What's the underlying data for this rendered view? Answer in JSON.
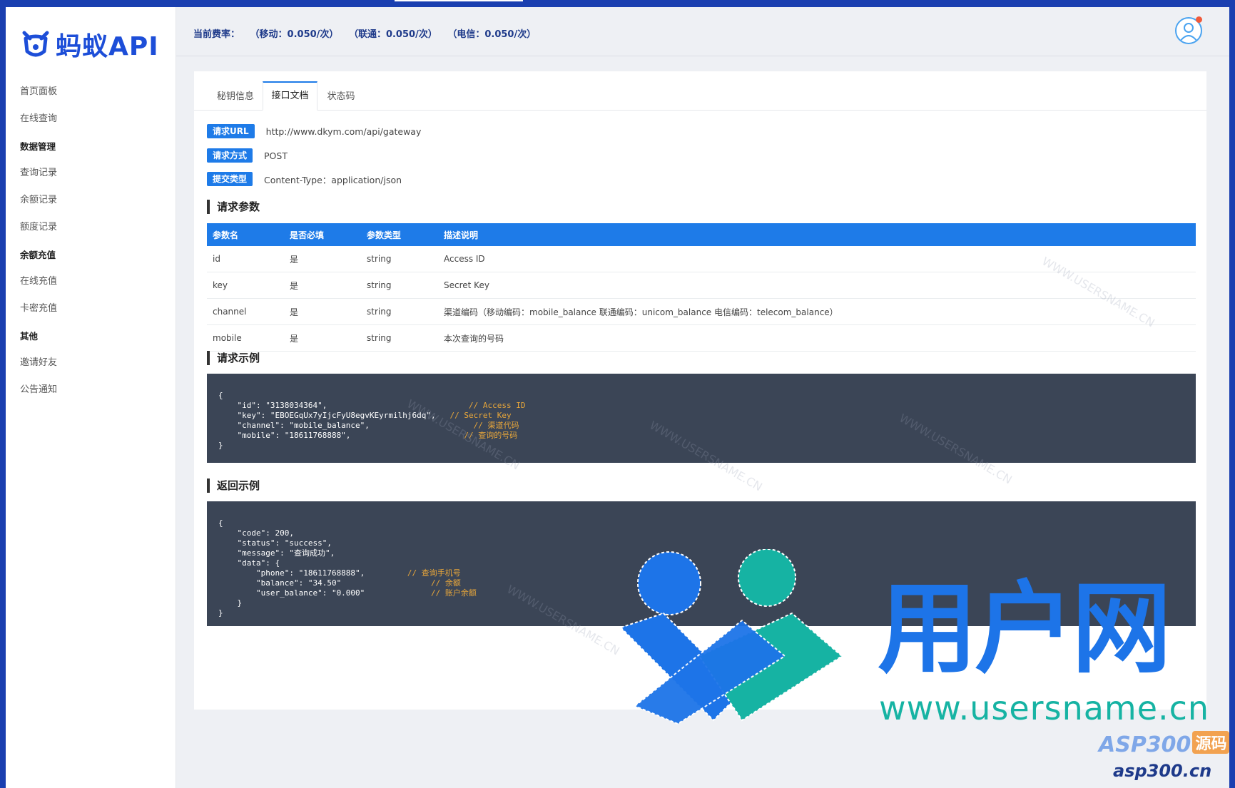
{
  "app": {
    "logo_text": "蚂蚁API"
  },
  "header": {
    "rate_label": "当前费率：",
    "rate_mobile": "（移动：0.050/次）",
    "rate_unicom": "（联通：0.050/次）",
    "rate_telecom": "（电信：0.050/次）"
  },
  "sidebar": {
    "home": "首页面板",
    "online_query": "在线查询",
    "group_data": "数据管理",
    "query_records": "查询记录",
    "balance_records": "余额记录",
    "quota_records": "额度记录",
    "group_recharge": "余额充值",
    "online_recharge": "在线充值",
    "card_recharge": "卡密充值",
    "group_other": "其他",
    "invite": "邀请好友",
    "notice": "公告通知"
  },
  "tabs": [
    "秘钥信息",
    "接口文档",
    "状态码"
  ],
  "info": {
    "url_tag": "请求URL",
    "url_val": "http://www.dkym.com/api/gateway",
    "method_tag": "请求方式",
    "method_val": "POST",
    "type_tag": "提交类型",
    "type_val": "Content-Type：application/json"
  },
  "sections": {
    "params": "请求参数",
    "req_example": "请求示例",
    "resp_example": "返回示例"
  },
  "params_table": {
    "headers": [
      "参数名",
      "是否必填",
      "参数类型",
      "描述说明"
    ],
    "rows": [
      [
        "id",
        "是",
        "string",
        "Access ID"
      ],
      [
        "key",
        "是",
        "string",
        "Secret Key"
      ],
      [
        "channel",
        "是",
        "string",
        "渠道编码（移动编码：mobile_balance 联通编码：unicom_balance 电信编码：telecom_balance）"
      ],
      [
        "mobile",
        "是",
        "string",
        "本次查询的号码"
      ]
    ]
  },
  "req_code": {
    "l0": "{",
    "l1": "    \"id\": \"3138034364\",",
    "c1": "// Access ID",
    "l2": "    \"key\": \"EBOEGqUx7yIjcFyU8egvKEyrmilhj6dq\",",
    "c2": "// Secret Key",
    "l3": "    \"channel\": \"mobile_balance\",",
    "c3": "// 渠道代码",
    "l4": "    \"mobile\": \"18611768888\",",
    "c4": "// 查询的号码",
    "l5": "}"
  },
  "resp_code": {
    "l0": "{",
    "l1": "    \"code\": 200,",
    "l2": "    \"status\": \"success\",",
    "l3": "    \"message\": \"查询成功\",",
    "l4": "    \"data\": {",
    "l5": "        \"phone\": \"18611768888\",",
    "c5": "// 查询手机号",
    "l6": "        \"balance\": \"34.50\"",
    "c6": "// 余额",
    "l7": "        \"user_balance\": \"0.000\"",
    "c7": "// 账户余额",
    "l8": "    }",
    "l9": "}"
  },
  "watermark": {
    "brand": "用户网",
    "url": "www.usersname.cn",
    "asp": "ASP300",
    "asp_badge": "源码",
    "asp_url": "asp300.cn",
    "faint": "WWW.USERSNAME.CN"
  },
  "colors": {
    "accent": "#1e7be8",
    "code_bg": "#3b4556",
    "comment": "#e9a73a",
    "sidebar_bg": "#ffffff"
  }
}
